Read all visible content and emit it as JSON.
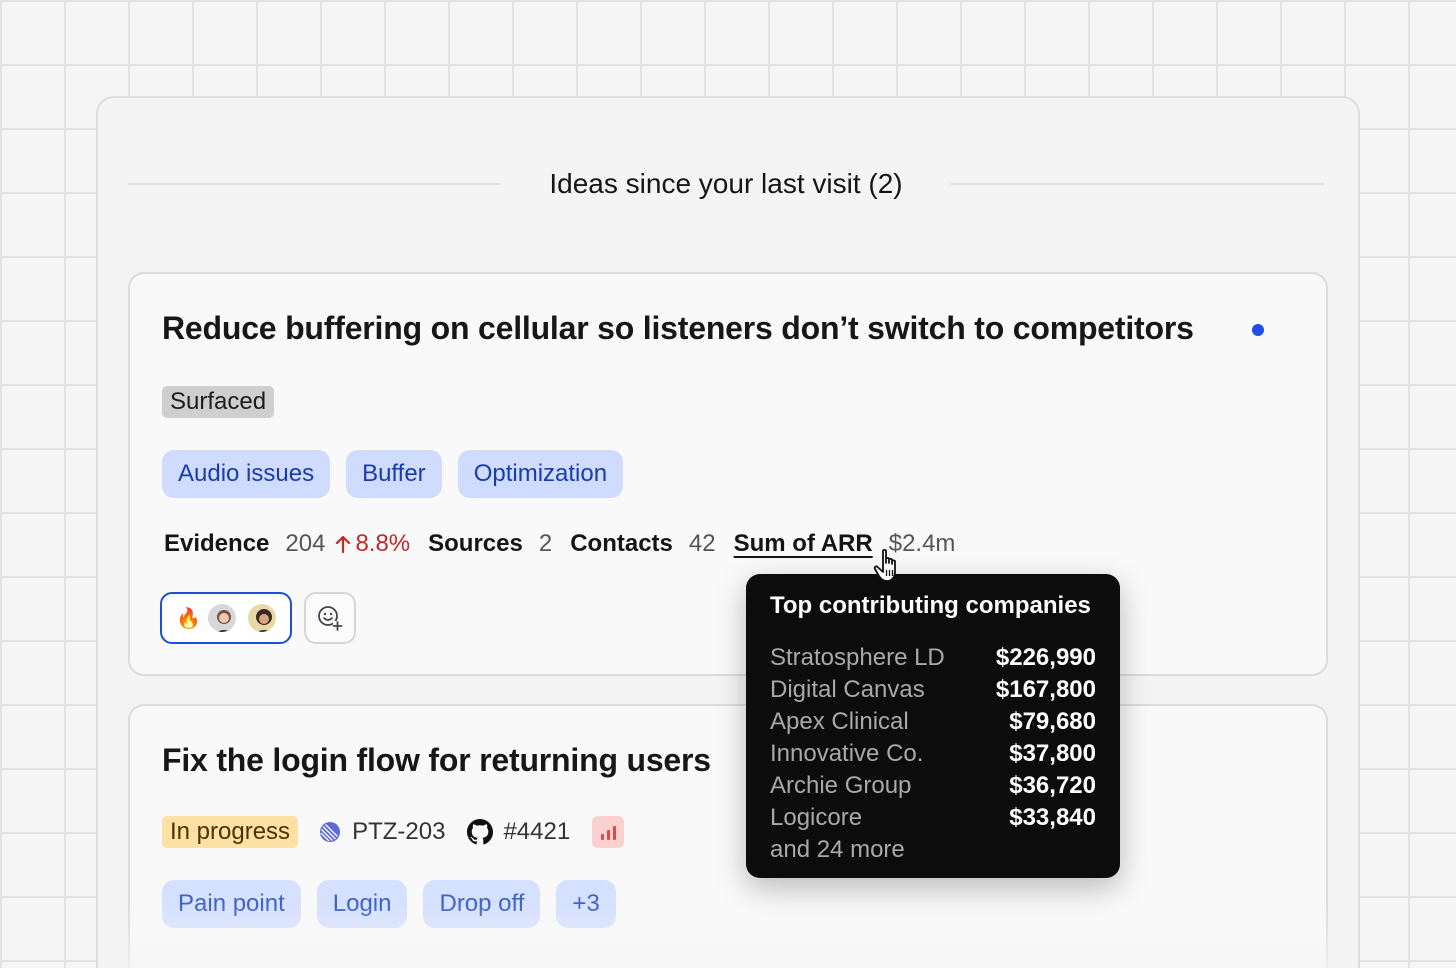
{
  "header": {
    "title": "Ideas since your last visit (2)"
  },
  "ideas": [
    {
      "title": "Reduce buffering on cellular so listeners don’t switch to competitors",
      "status": "Surfaced",
      "tags": [
        "Audio issues",
        "Buffer",
        "Optimization"
      ],
      "metrics": {
        "evidence_label": "Evidence",
        "evidence_value": "204",
        "evidence_trend": "8.8%",
        "sources_label": "Sources",
        "sources_value": "2",
        "contacts_label": "Contacts",
        "contacts_value": "42",
        "arr_label": "Sum of ARR",
        "arr_value": "$2.4m"
      },
      "reactions": {
        "emoji": "🔥"
      }
    },
    {
      "title": "Fix the login flow for returning users",
      "status": "In progress",
      "linear_issue": "PTZ-203",
      "github_pr": "#4421",
      "tags": [
        "Pain point",
        "Login",
        "Drop off",
        "+3"
      ]
    }
  ],
  "tooltip": {
    "title": "Top contributing companies",
    "rows": [
      {
        "name": "Stratosphere LD",
        "amount": "$226,990"
      },
      {
        "name": "Digital Canvas",
        "amount": "$167,800"
      },
      {
        "name": "Apex Clinical",
        "amount": "$79,680"
      },
      {
        "name": "Innovative Co.",
        "amount": "$37,800"
      },
      {
        "name": "Archie Group",
        "amount": "$36,720"
      },
      {
        "name": "Logicore",
        "amount": "$33,840"
      }
    ],
    "more": "and 24 more"
  },
  "colors": {
    "accent": "#1d4ee8",
    "tag_bg": "#cfdcff",
    "trend_up": "#c72727"
  }
}
